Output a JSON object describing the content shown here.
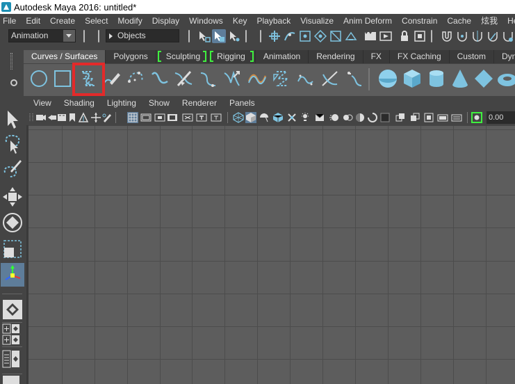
{
  "window": {
    "title": "Autodesk Maya 2016: untitled*"
  },
  "menubar": {
    "items": [
      "File",
      "Edit",
      "Create",
      "Select",
      "Modify",
      "Display",
      "Windows",
      "Key",
      "Playback",
      "Visualize",
      "Anim Deform",
      "Constrain",
      "Cache",
      "炫我",
      "Help"
    ]
  },
  "statusline": {
    "mode_value": "Animation",
    "selection_mode_value": "Objects"
  },
  "shelf": {
    "tabs": [
      "Curves / Surfaces",
      "Polygons",
      "Sculpting",
      "Rigging",
      "Animation",
      "Rendering",
      "FX",
      "FX Caching",
      "Custom",
      "Dynami"
    ],
    "active_tab": "Curves / Surfaces",
    "icons": [
      "nurbs-circle-icon",
      "nurbs-square-icon",
      "cv-curve-tool-icon",
      "pencil-curve-tool-icon",
      "ep-curve-tool-icon",
      "bezier-curve-tool-icon",
      "attach-curves-icon",
      "detach-curves-icon",
      "insert-knot-icon",
      "extend-curve-icon",
      "offset-curve-icon",
      "rebuild-curve-icon",
      "reverse-curve-icon",
      "fillet-curve-icon",
      "cut-curve-icon",
      "intersect-curves-icon",
      "nurbs-sphere-icon",
      "nurbs-cube-icon",
      "nurbs-cylinder-icon",
      "nurbs-cone-icon",
      "nurbs-plane-icon",
      "nurbs-torus-icon"
    ],
    "accent_color": "#7ec3e0",
    "highlight_color": "#e32a2a"
  },
  "panel_menu": {
    "items": [
      "View",
      "Shading",
      "Lighting",
      "Show",
      "Renderer",
      "Panels"
    ]
  },
  "panel_toolbar": {
    "exposure_value": "0.00"
  },
  "viewport": {
    "background_color": "#5d5d5d",
    "grid_color": "#4c4c4c"
  }
}
